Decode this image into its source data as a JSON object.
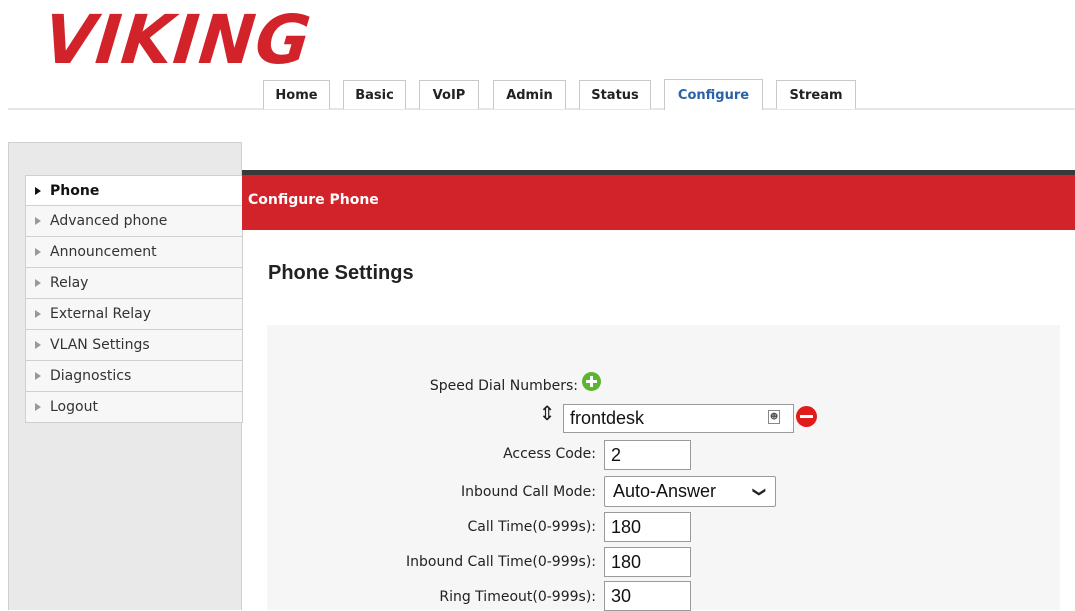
{
  "brand": {
    "logo_text": "VIKING"
  },
  "nav": {
    "tabs": [
      {
        "label": "Home"
      },
      {
        "label": "Basic"
      },
      {
        "label": "VoIP"
      },
      {
        "label": "Admin"
      },
      {
        "label": "Status"
      },
      {
        "label": "Configure",
        "active": true
      },
      {
        "label": "Stream"
      }
    ]
  },
  "sidebar": {
    "items": [
      {
        "label": "Phone",
        "active": true
      },
      {
        "label": "Advanced phone"
      },
      {
        "label": "Announcement"
      },
      {
        "label": "Relay"
      },
      {
        "label": "External Relay"
      },
      {
        "label": "VLAN Settings"
      },
      {
        "label": "Diagnostics"
      },
      {
        "label": "Logout"
      }
    ]
  },
  "header": {
    "title": "Configure Phone"
  },
  "section": {
    "title": "Phone Settings"
  },
  "form": {
    "speed_dial": {
      "label": "Speed Dial Numbers:",
      "value": "frontdesk"
    },
    "access_code": {
      "label": "Access Code:",
      "value": "2"
    },
    "inbound_call_mode": {
      "label": "Inbound Call Mode:",
      "value": "Auto-Answer"
    },
    "call_time": {
      "label": "Call Time(0-999s):",
      "value": "180"
    },
    "inbound_call_time": {
      "label": "Inbound Call Time(0-999s):",
      "value": "180"
    },
    "ring_timeout": {
      "label": "Ring Timeout(0-999s):",
      "value": "30"
    }
  },
  "icons": {
    "add": "plus-circle-icon",
    "remove": "minus-circle-icon",
    "drag": "drag-handle-icon",
    "contact": "contact-card-icon",
    "dropdown": "chevron-down-icon"
  },
  "colors": {
    "brand_red": "#d2232a",
    "active_tab": "#2a62a8",
    "add_green": "#5cb531",
    "remove_red": "#e01b1b"
  }
}
